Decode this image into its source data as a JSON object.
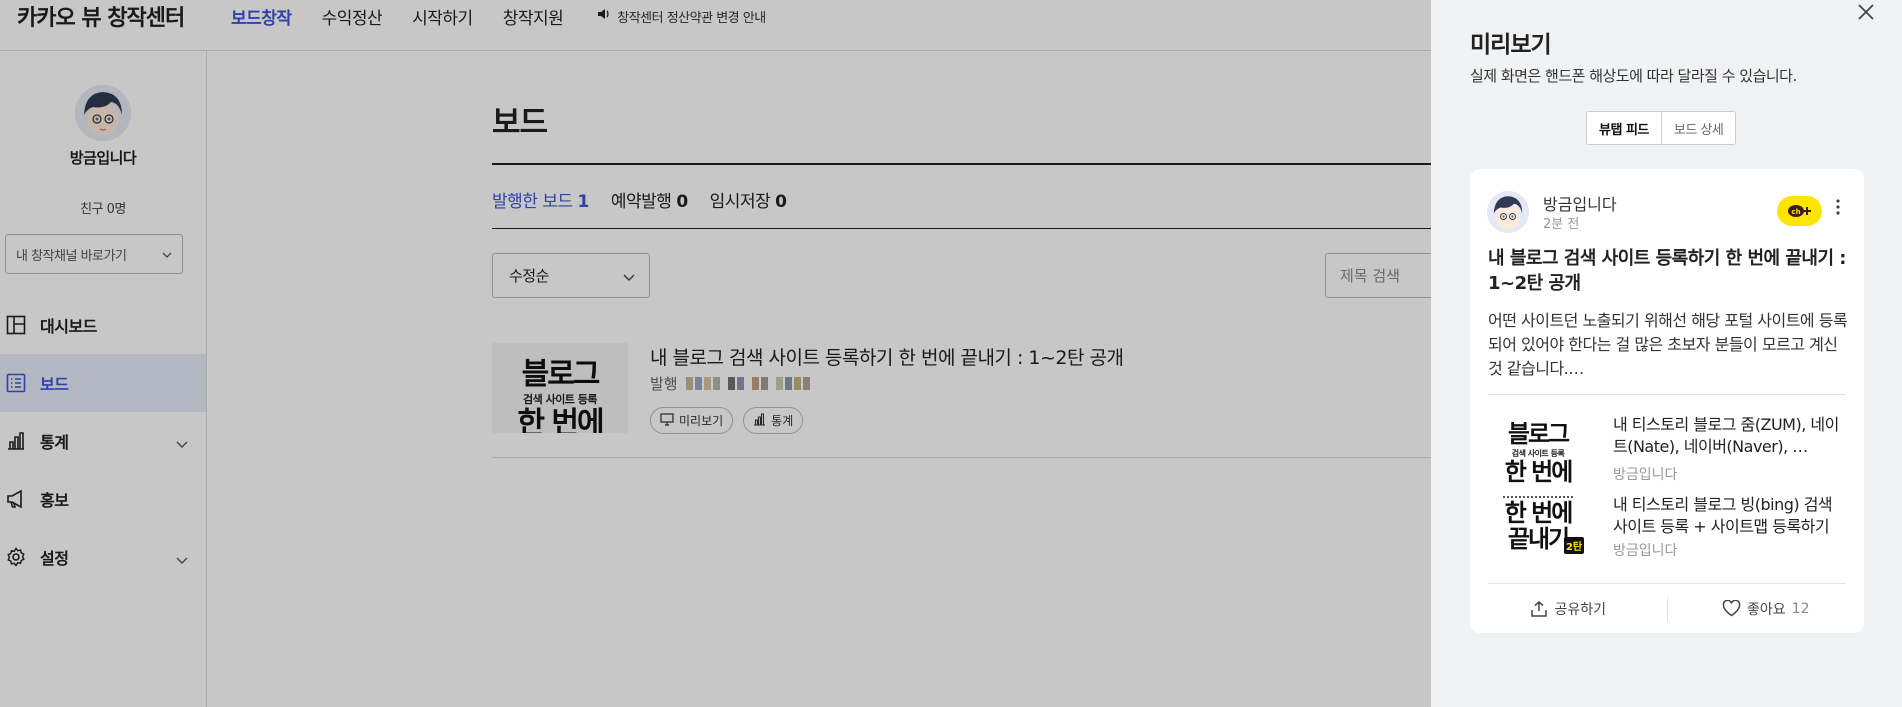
{
  "header": {
    "logo": "카카오 뷰 창작센터",
    "nav": [
      {
        "label": "보드창작",
        "active": true
      },
      {
        "label": "수익정산",
        "active": false
      },
      {
        "label": "시작하기",
        "active": false
      },
      {
        "label": "창작지원",
        "active": false
      }
    ],
    "notice": "창작센터 정산약관 변경 안내"
  },
  "sidebar": {
    "profile_name": "방금입니다",
    "friends_label": "친구",
    "friends_count": "0명",
    "channel_select": "내 창작채널 바로가기",
    "menu": [
      {
        "label": "대시보드",
        "icon": "dashboard-icon",
        "active": false,
        "chevron": false
      },
      {
        "label": "보드",
        "icon": "list-icon",
        "active": true,
        "chevron": false
      },
      {
        "label": "통계",
        "icon": "bar-chart-icon",
        "active": false,
        "chevron": true
      },
      {
        "label": "홍보",
        "icon": "megaphone-icon",
        "active": false,
        "chevron": false
      },
      {
        "label": "설정",
        "icon": "gear-icon",
        "active": false,
        "chevron": true
      }
    ]
  },
  "main": {
    "title": "보드",
    "tabs": [
      {
        "label": "발행한 보드",
        "count": "1",
        "active": true
      },
      {
        "label": "예약발행",
        "count": "0",
        "active": false
      },
      {
        "label": "임시저장",
        "count": "0",
        "active": false
      }
    ],
    "sort_value": "수정순",
    "search_placeholder": "제목 검색",
    "board": {
      "title": "내 블로그 검색 사이트 등록하기 한 번에 끝내기 : 1~2탄 공개",
      "status": "발행",
      "thumb_line1": "블로그",
      "thumb_line2": "검색 사이트 등록",
      "thumb_line3": "한 번에",
      "preview_button": "미리보기",
      "stats_button": "통계"
    }
  },
  "preview": {
    "title": "미리보기",
    "description": "실제 화면은 핸드폰 해상도에 따라 달라질 수 있습니다.",
    "segments": [
      {
        "label": "뷰탭 피드",
        "active": true
      },
      {
        "label": "보드 상세",
        "active": false
      }
    ],
    "card": {
      "author": "방금입니다",
      "time": "2분 전",
      "badge": "ch+",
      "title": "내 블로그 검색 사이트 등록하기 한 번에 끝내기 : 1~2탄 공개",
      "summary": "어떤 사이트던 노출되기 위해선 해당 포털 사이트에 등록되어 있어야 한다는 걸 많은 초보자 분들이 모르고 계신 것 같습니다.…",
      "related": [
        {
          "title": "내 티스토리 블로그 줌(ZUM), 네이트(Nate), 네이버(Naver), …",
          "author": "방금입니다",
          "thumb_line1": "블로그",
          "thumb_line2": "검색 사이트 등록",
          "thumb_line3": "한 번에"
        },
        {
          "title": "내 티스토리 블로그 빙(bing) 검색 사이트 등록 + 사이트맵 등록하기",
          "author": "방금입니다",
          "thumb_line1": "한 번에",
          "thumb_line2": "끝내기",
          "thumb_badge": "2탄"
        }
      ],
      "share_label": "공유하기",
      "like_label": "좋아요",
      "like_count": "12"
    }
  },
  "colors": {
    "accent": "#3b55d6",
    "kakao_yellow": "#fee500",
    "overlay": "rgba(0,0,0,0.22)",
    "panel_bg": "#f1f2f4"
  }
}
